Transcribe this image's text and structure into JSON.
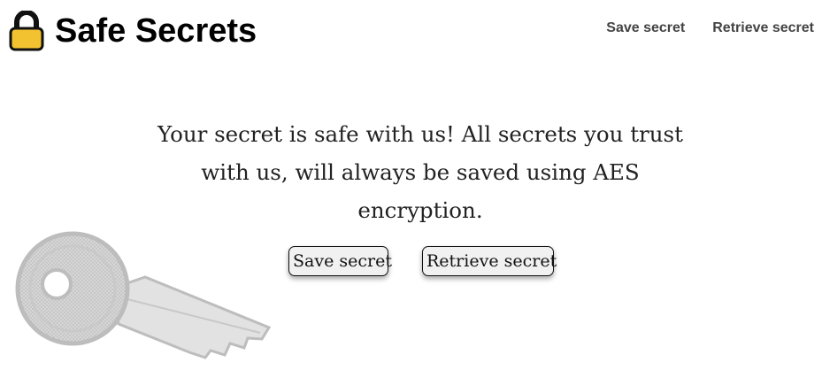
{
  "header": {
    "brand": "Safe Secrets",
    "logo_icon": "padlock-icon",
    "nav": {
      "save_label": "Save secret",
      "retrieve_label": "Retrieve secret"
    }
  },
  "main": {
    "tagline": "Your secret is safe with us! All secrets you trust with us, will always be saved using AES encryption.",
    "buttons": {
      "save_label": "Save secret",
      "retrieve_label": "Retrieve secret"
    },
    "decoration_icon": "key-icon"
  },
  "colors": {
    "padlock_body": "#f2c230",
    "padlock_shackle": "#111111",
    "nav_text": "#444444",
    "button_bg": "#f1f1f1",
    "key_fill": "#dcdcdc"
  }
}
